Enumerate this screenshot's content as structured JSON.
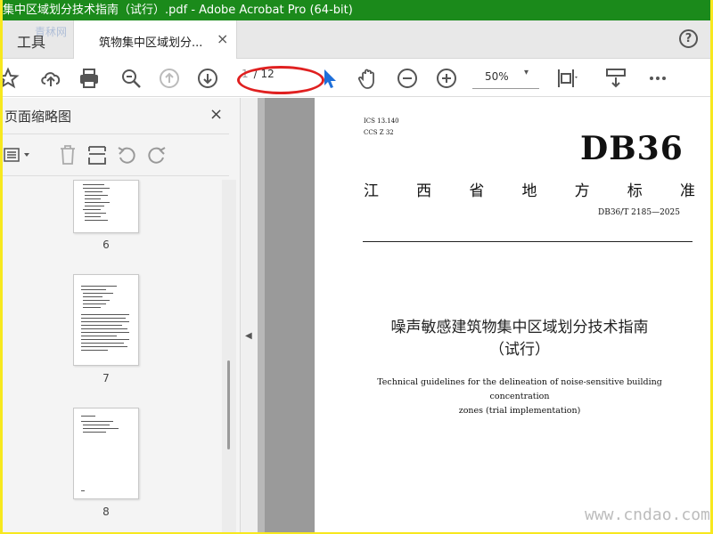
{
  "app": {
    "window_title": "集中区域划分技术指南（试行）.pdf - Adobe Acrobat Pro (64-bit)",
    "watermark_top": "青秫网",
    "watermark_bottom": "www.cndao.com"
  },
  "tabs": {
    "tools_label": "工具",
    "document_tab_label": "筑物集中区域划分...",
    "close_glyph": "×",
    "help_glyph": "?"
  },
  "toolbar": {
    "page_current": "1",
    "page_total": "/ 12",
    "zoom_value": "50%",
    "zoom_caret": "▾",
    "icons": [
      "star-icon",
      "upload-cloud-icon",
      "print-icon",
      "zoom-search-icon",
      "page-up-icon",
      "page-down-icon",
      "select-cursor-icon",
      "hand-tool-icon",
      "zoom-out-icon",
      "zoom-in-icon",
      "fit-page-icon",
      "scroll-mode-icon",
      "more-icon"
    ]
  },
  "left_panel": {
    "title": "页面缩略图",
    "close_glyph": "×",
    "collapse_glyph": "◀",
    "thumbnails": [
      {
        "page_label": "6"
      },
      {
        "page_label": "7"
      },
      {
        "page_label": "8"
      }
    ]
  },
  "document": {
    "ics": "ICS  13.140",
    "ccs": "CCS  Z  32",
    "standard_code": "DB36",
    "province_chars": [
      "江",
      "西",
      "省",
      "地",
      "方",
      "标",
      "准"
    ],
    "standard_number": "DB36/T  2185—2025",
    "title_cn_line1": "噪声敏感建筑物集中区域划分技术指南",
    "title_cn_line2": "（试行）",
    "title_en_line1": "Technical guidelines for the delineation of noise-sensitive building concentration",
    "title_en_line2": "zones (trial implementation)"
  },
  "colors": {
    "title_bar": "#1b8a1b",
    "frame_border": "#f7e81e",
    "annotation_oval": "#e02020",
    "cursor_blue": "#1e6fd9"
  }
}
